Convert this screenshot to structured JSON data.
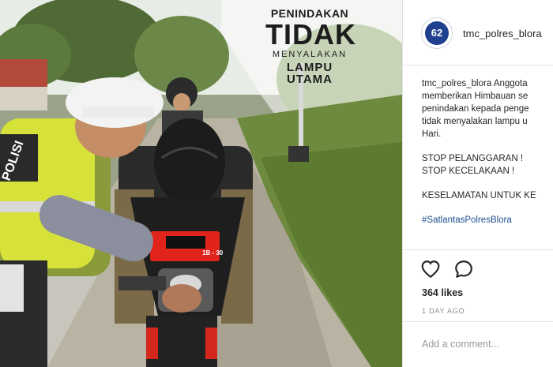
{
  "photo": {
    "overlay": {
      "line1": "PENINDAKAN",
      "line2": "TIDAK",
      "line3": "MENYALAKAN",
      "line4": "LAMPU UTAMA"
    },
    "officer_vest_text": "POLISI",
    "plate_text": "1B - 30"
  },
  "header": {
    "avatar_text": "62",
    "username": "tmc_polres_blora"
  },
  "caption": {
    "username": "tmc_polres_blora",
    "lines": [
      "Anggota",
      "memberikan Himbauan se",
      "penindakan kepada penge",
      "tidak menyalakan lampu u",
      "Hari."
    ],
    "slogan1": "STOP PELANGGARAN !",
    "slogan2": "STOP KECELAKAAN !",
    "slogan3": "KESELAMATAN UNTUK KE",
    "hashtag": "#SatlantasPolresBlora"
  },
  "actions": {
    "like_icon": "heart-icon",
    "comment_icon": "comment-bubble-icon"
  },
  "likes": "364 likes",
  "timestamp": "1 DAY AGO",
  "comment": {
    "placeholder": "Add a comment..."
  }
}
